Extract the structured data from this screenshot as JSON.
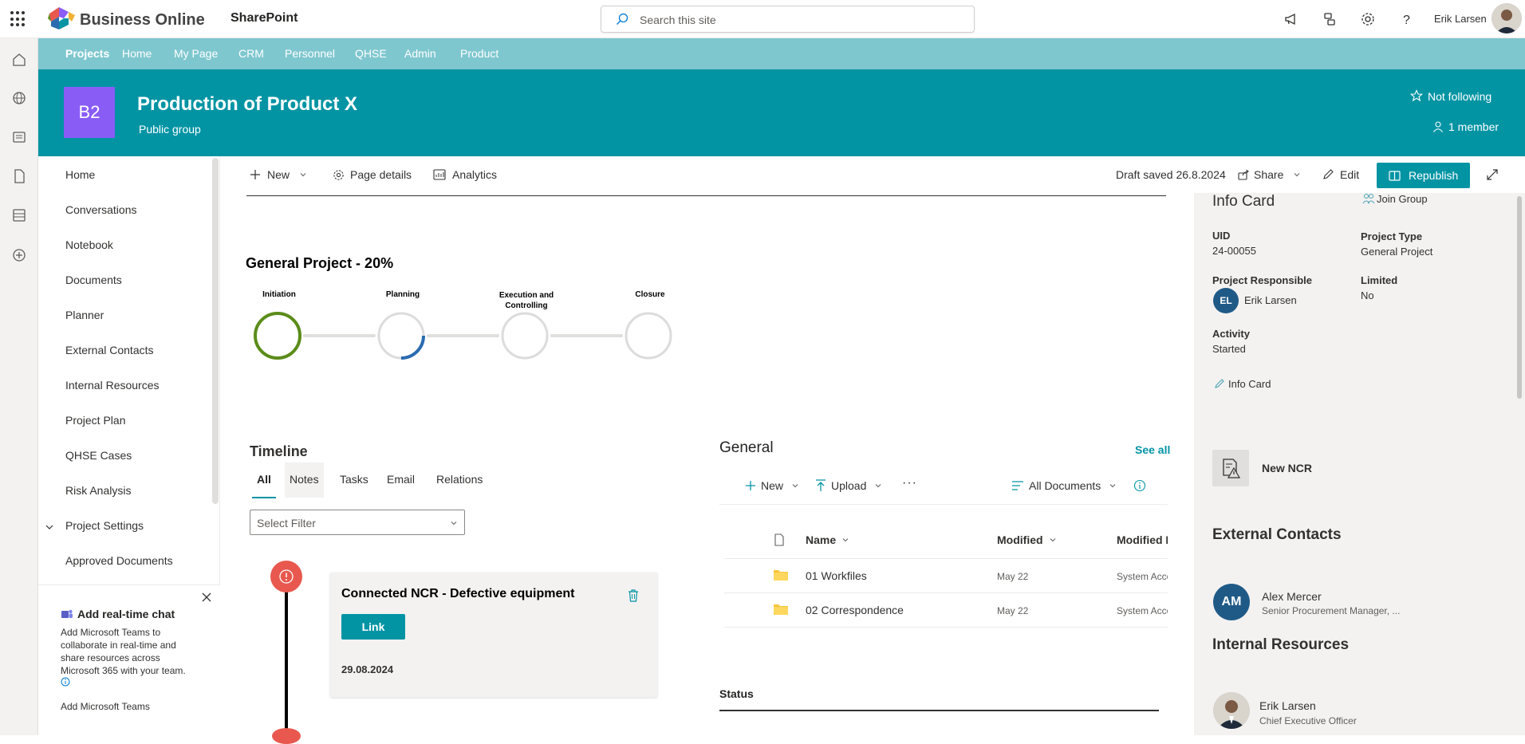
{
  "suite": {
    "brand": "Business Online",
    "app": "SharePoint",
    "search_placeholder": "Search this site",
    "user_name": "Erik Larsen"
  },
  "hub_nav": [
    "Projects",
    "Home",
    "My Page",
    "CRM",
    "Personnel",
    "QHSE",
    "Admin",
    "Product"
  ],
  "header": {
    "logo_text": "B2",
    "title": "Production of Product X",
    "subtitle": "Public group",
    "follow": "Not following",
    "members": "1 member"
  },
  "left_nav": {
    "items": [
      "Home",
      "Conversations",
      "Notebook",
      "Documents",
      "Planner",
      "External Contacts",
      "Internal Resources",
      "Project Plan",
      "QHSE Cases",
      "Risk Analysis",
      "Project Settings",
      "Approved Documents"
    ],
    "selected": "Project Settings"
  },
  "chat": {
    "title": "Add real-time chat",
    "body": "Add Microsoft Teams to collaborate in real-time and share resources across Microsoft 365 with your team.",
    "link": "Add Microsoft Teams"
  },
  "command_bar": {
    "new": "New",
    "page_details": "Page details",
    "analytics": "Analytics",
    "draft": "Draft saved 26.8.2024",
    "share": "Share",
    "edit": "Edit",
    "republish": "Republish"
  },
  "progress": {
    "title": "General Project  - 20%",
    "stages": [
      {
        "label": "Initiation",
        "fill": 1.0,
        "color": "#5b8c1a"
      },
      {
        "label": "Planning",
        "fill": 0.25,
        "color": "#2b6cb0"
      },
      {
        "label": "Execution and Controlling",
        "fill": 0,
        "color": "#2b6cb0"
      },
      {
        "label": "Closure",
        "fill": 0,
        "color": "#2b6cb0"
      }
    ]
  },
  "timeline": {
    "title": "Timeline",
    "tabs": [
      "All",
      "Notes",
      "Tasks",
      "Email",
      "Relations"
    ],
    "filter_placeholder": "Select Filter",
    "card": {
      "title": "Connected NCR - Defective equipment",
      "link": "Link",
      "date": "29.08.2024"
    }
  },
  "general": {
    "title": "General",
    "see_all": "See all",
    "new": "New",
    "upload": "Upload",
    "view": "All Documents",
    "columns": [
      "Name",
      "Modified",
      "Modified I"
    ],
    "rows": [
      {
        "name": "01 Workfiles",
        "modified": "May 22",
        "by": "System Acco"
      },
      {
        "name": "02 Correspondence",
        "modified": "May 22",
        "by": "System Acco"
      }
    ],
    "status": "Status"
  },
  "info_card": {
    "title": "Info Card",
    "join": "Join Group",
    "uid_label": "UID",
    "uid": "24-00055",
    "type_label": "Project Type",
    "type": "General Project",
    "resp_label": "Project Responsible",
    "resp_initials": "EL",
    "resp": "Erik Larsen",
    "limited_label": "Limited",
    "limited": "No",
    "activity_label": "Activity",
    "activity": "Started",
    "edit_link": "Info Card",
    "new_ncr": "New NCR",
    "ext_title": "External Contacts",
    "ext_initials": "AM",
    "ext_name": "Alex Mercer",
    "ext_role": "Senior Procurement Manager, ...",
    "int_title": "Internal Resources",
    "int_name": "Erik Larsen",
    "int_role": "Chief Executive Officer"
  },
  "colors": {
    "teal": "#0394a4",
    "hub": "#7fc7cf",
    "purple": "#8a5cf6",
    "red": "#e8584e",
    "navy": "#1f5a87"
  }
}
